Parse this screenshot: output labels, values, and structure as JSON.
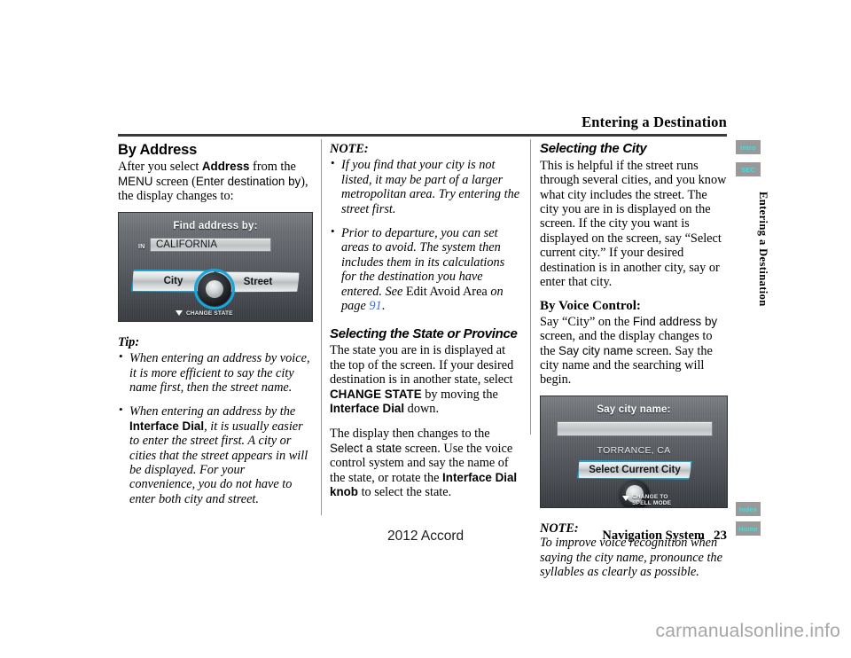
{
  "page": {
    "running_head": "Entering a Destination",
    "side_label": "Entering a Destination",
    "model": "2012 Accord",
    "footer_label": "Navigation System",
    "page_number": "23",
    "watermark": "carmanualsonline.info"
  },
  "tabs": [
    {
      "label": "Intro"
    },
    {
      "label": "SEC"
    },
    {
      "label": "Index"
    },
    {
      "label": "Home"
    }
  ],
  "colors": {
    "tab_bg": "#999999",
    "tab_text": "#2ee6e6",
    "link": "#3b6fd4",
    "nav_highlight": "#17a6da"
  },
  "col1": {
    "heading": "By Address",
    "intro_a": "After you select ",
    "intro_b": "Address",
    "intro_c": " from the ",
    "intro_d": "MENU",
    "intro_e": " screen (",
    "intro_f": "Enter destination by",
    "intro_g": "), the display changes to:",
    "tip_head": "Tip:",
    "tips": [
      {
        "text_a": "When entering an address by voice, it is more efficient to say the city name first, then the street name.",
        "bold": "",
        "text_b": ""
      },
      {
        "text_a": "When entering an address by the ",
        "bold": "Interface Dial",
        "text_b": ", it is usually easier to enter the street first. A city or cities that the street appears in will be displayed. For your convenience, you do not have to enter both city and street."
      }
    ]
  },
  "nav_screen_1": {
    "title": "Find address by:",
    "in_label": "IN",
    "field_value": "CALIFORNIA",
    "button_left": "City",
    "button_right": "Street",
    "hint": "CHANGE STATE",
    "selected": "City"
  },
  "col2": {
    "note_head": "NOTE:",
    "notes": [
      "If you find that your city is not listed, it may be part of a larger metropolitan area. Try entering the street first.",
      "Prior to departure, you can set areas to avoid. The system then includes them in its calculations for the destination you have entered. See "
    ],
    "note2_ref_plain": "Edit Avoid Area",
    "note2_ref_italic": " on page ",
    "note2_page": "91",
    "note2_end": ".",
    "heading": "Selecting the State or Province",
    "p1_a": "The state you are in is displayed at the top of the screen. If your desired destination is in another state, select ",
    "p1_b": "CHANGE STATE",
    "p1_c": " by moving the ",
    "p1_d": "Interface Dial",
    "p1_e": " down.",
    "p2_a": "The display then changes to the ",
    "p2_b": "Select a state",
    "p2_c": " screen. Use the voice control system and say the name of the state, or rotate the ",
    "p2_d": "Interface Dial knob",
    "p2_e": " to select the state."
  },
  "col3": {
    "heading": "Selecting the City",
    "p1": "This is helpful if the street runs through several cities, and you know what city includes the street. The city you are in is displayed on the screen. If the city you want is displayed on the screen, say “Select current city.” If your desired destination is in another city, say or enter that city.",
    "subhead": "By Voice Control:",
    "p2_a": "Say “City” on the ",
    "p2_b": "Find address by",
    "p2_c": " screen, and the display changes to the ",
    "p2_d": "Say city name",
    "p2_e": " screen. Say the city name and the searching will begin.",
    "note_head": "NOTE:",
    "note_body": "To improve voice recognition when saying the city name, pronounce the syllables as clearly as possible."
  },
  "nav_screen_2": {
    "title": "Say city name:",
    "field_value": "",
    "caption": "TORRANCE, CA",
    "button": "Select Current City",
    "hint_line1": "CHANGE TO",
    "hint_line2": "SPELL MODE"
  }
}
